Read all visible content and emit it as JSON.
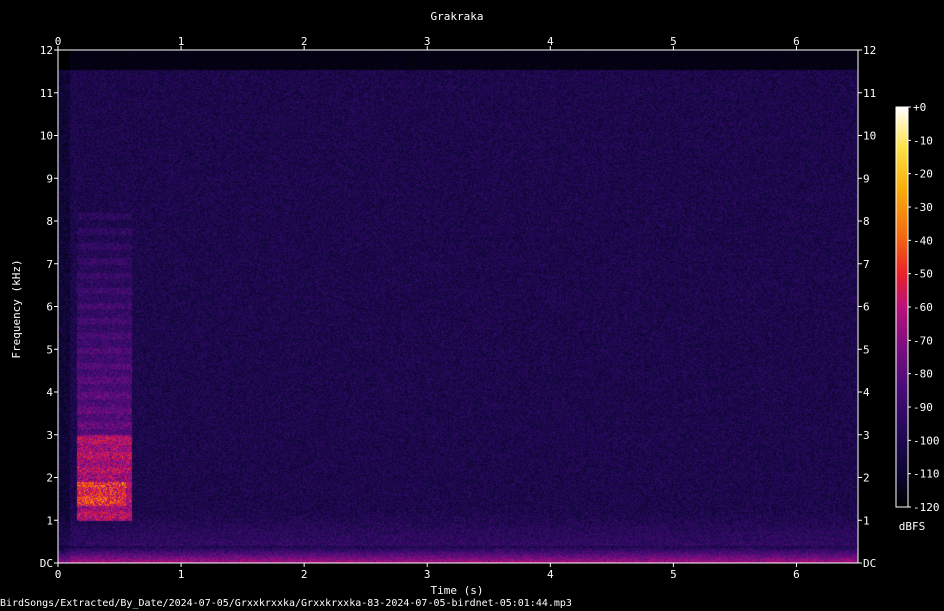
{
  "chart_data": {
    "type": "heatmap",
    "title": "Grakraka",
    "xlabel": "Time (s)",
    "ylabel": "Frequency (kHz)",
    "xlim": [
      0,
      6.5
    ],
    "ylim": [
      0,
      12
    ],
    "x_ticks": [
      "0",
      "1",
      "2",
      "3",
      "4",
      "5",
      "6"
    ],
    "y_ticks": [
      "DC",
      "1",
      "2",
      "3",
      "4",
      "5",
      "6",
      "7",
      "8",
      "9",
      "10",
      "11",
      "12"
    ],
    "colorbar": {
      "label": "dBFS",
      "range": [
        -120,
        0
      ],
      "ticks": [
        "+0",
        "-10",
        "-20",
        "-30",
        "-40",
        "-50",
        "-60",
        "-70",
        "-80",
        "-90",
        "-100",
        "-110",
        "-120"
      ]
    },
    "features": [
      {
        "label": "call",
        "t_range": [
          0.15,
          0.6
        ],
        "f_range": [
          1.0,
          8.2
        ],
        "peak_f_range": [
          1.3,
          3.0
        ],
        "level_dbfs": -55
      },
      {
        "label": "low-frequency band",
        "t_range": [
          0,
          6.5
        ],
        "f_range": [
          0,
          0.4
        ],
        "level_dbfs": -65
      }
    ],
    "background_level_dbfs": -100
  },
  "footer": {
    "path": "BirdSongs/Extracted/By_Date/2024-07-05/Grxxkrxxka/Grxxkrxxka-83-2024-07-05-birdnet-05:01:44.mp3"
  },
  "colors": {
    "background": "#000000",
    "text": "#ffffff",
    "colormap": [
      "#000000",
      "#0b0530",
      "#250a5a",
      "#4a0c77",
      "#7a0e7f",
      "#b8127a",
      "#e8202c",
      "#f56a10",
      "#f9b00a",
      "#fde24a",
      "#ffffff"
    ]
  }
}
